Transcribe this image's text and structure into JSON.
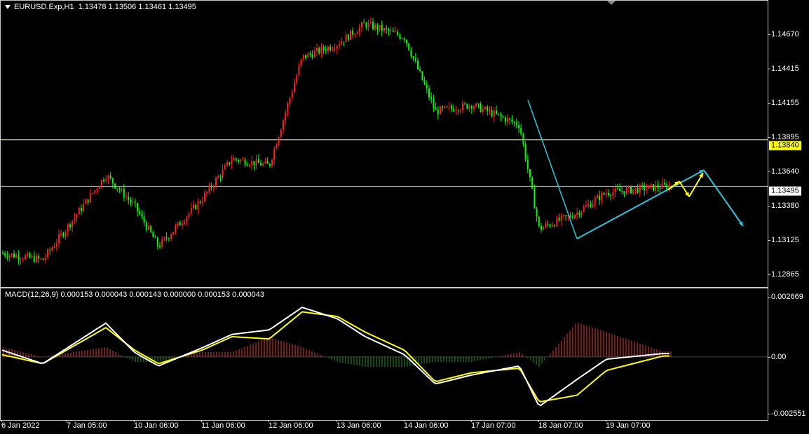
{
  "header": {
    "symbol_timeframe": "EURUSD.Exp,H1",
    "ohlc": "1.13478 1.13506 1.13461 1.13495"
  },
  "price_axis": {
    "ticks": [
      "1.14670",
      "1.14415",
      "1.14155",
      "1.13895",
      "1.13640",
      "1.13380",
      "1.13125",
      "1.12865"
    ],
    "highlight_line_label": "1.13840",
    "current_price_label": "1.13495"
  },
  "indicator": {
    "label": "MACD(12,26,9) 0.000153 0.000043 0.000143 0.000000 0.000153 0.000043",
    "ticks": [
      "0.002669",
      "0.00",
      "-0.002551"
    ]
  },
  "time_axis": {
    "labels": [
      "6 Jan 2022",
      "7 Jan 05:00",
      "10 Jan 06:00",
      "11 Jan 06:00",
      "12 Jan 06:00",
      "13 Jan 06:00",
      "14 Jan 06:00",
      "17 Jan 07:00",
      "18 Jan 07:00",
      "19 Jan 07:00"
    ]
  },
  "colors": {
    "bull": "#ff2020",
    "bear": "#00ff00",
    "hline": "#ffff80",
    "current_line": "#c0c0c0",
    "arrow_cyan": "#28c8dc",
    "arrow_yellow": "#ffff00",
    "macd_line": "#ffffff",
    "signal_line": "#ffff00",
    "hist_pos": "#c03030",
    "hist_neg": "#208020"
  },
  "chart_data": [
    {
      "type": "candlestick",
      "series_name": "EURUSD.Exp,H1",
      "timeframe": "H1",
      "ylim": [
        1.1274,
        1.1487
      ],
      "last_price": 1.13495,
      "horizontal_line": 1.1384,
      "approx_closes_by_session": [
        {
          "x": "6 Jan 2022",
          "close": 1.13
        },
        {
          "x": "7 Jan 05:00",
          "close": 1.1295
        },
        {
          "x": "7 Jan late",
          "close": 1.1358
        },
        {
          "x": "10 Jan 06:00",
          "close": 1.1335
        },
        {
          "x": "10 Jan late",
          "close": 1.1305
        },
        {
          "x": "11 Jan 06:00",
          "close": 1.134
        },
        {
          "x": "11 Jan late",
          "close": 1.137
        },
        {
          "x": "12 Jan 06:00",
          "close": 1.1365
        },
        {
          "x": "12 Jan late",
          "close": 1.1445
        },
        {
          "x": "13 Jan 06:00",
          "close": 1.1455
        },
        {
          "x": "13 Jan late",
          "close": 1.147
        },
        {
          "x": "14 Jan 06:00",
          "close": 1.146
        },
        {
          "x": "14 Jan late",
          "close": 1.1405
        },
        {
          "x": "17 Jan 07:00",
          "close": 1.141
        },
        {
          "x": "17 Jan late",
          "close": 1.1395
        },
        {
          "x": "18 Jan 07:00",
          "close": 1.1318
        },
        {
          "x": "18 Jan late",
          "close": 1.133
        },
        {
          "x": "19 Jan 07:00",
          "close": 1.1345
        },
        {
          "x": "19 Jan late",
          "close": 1.13495
        }
      ]
    },
    {
      "type": "line",
      "series_name": "MACD(12,26,9)",
      "ylim": [
        -0.002551,
        0.002669
      ],
      "x": [
        "6 Jan 2022",
        "7 Jan 05:00",
        "7 Jan late",
        "10 Jan 06:00",
        "10 Jan late",
        "11 Jan 06:00",
        "11 Jan late",
        "12 Jan 06:00",
        "12 Jan late",
        "13 Jan 06:00",
        "13 Jan late",
        "14 Jan 06:00",
        "14 Jan late",
        "17 Jan 07:00",
        "17 Jan late",
        "18 Jan 07:00",
        "18 Jan late",
        "19 Jan 07:00",
        "19 Jan late"
      ],
      "series": [
        {
          "name": "main",
          "values": [
            0.0003,
            -0.0003,
            0.0015,
            0.0002,
            -0.0004,
            0.0004,
            0.001,
            0.0012,
            0.0022,
            0.0017,
            0.0009,
            0.0001,
            -0.0012,
            -0.0008,
            -0.0004,
            -0.0022,
            -0.001,
            -0.0001,
            0.000153
          ]
        },
        {
          "name": "signal",
          "values": [
            0.0001,
            -0.0003,
            0.0013,
            0.0003,
            -0.0003,
            0.0003,
            0.0009,
            0.0008,
            0.002,
            0.0018,
            0.0011,
            0.0003,
            -0.0011,
            -0.0007,
            -0.0005,
            -0.002,
            -0.0017,
            -0.0006,
            4.3e-05
          ]
        },
        {
          "name": "histogram",
          "values": [
            0.0002,
            0.0,
            0.0002,
            -0.0001,
            -0.0001,
            0.0001,
            0.0001,
            0.0004,
            0.0002,
            -0.0001,
            -0.0002,
            -0.0002,
            -0.0001,
            -0.0001,
            0.0001,
            -0.0002,
            0.0007,
            0.0005,
            0.00011
          ]
        }
      ]
    }
  ]
}
